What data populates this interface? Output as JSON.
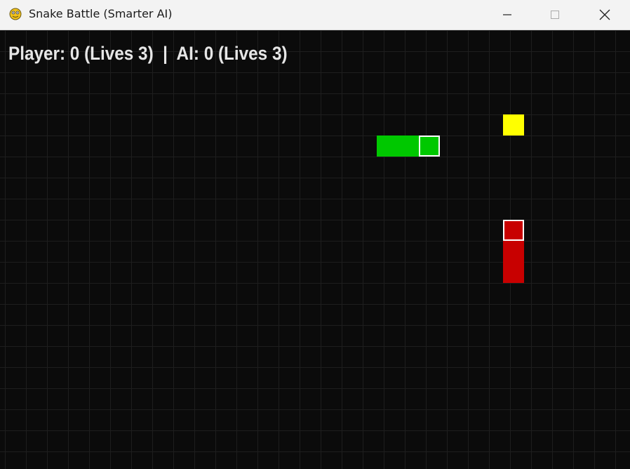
{
  "window": {
    "title": "Snake Battle (Smarter AI)",
    "app_icon": "pygame-snake-icon",
    "controls": [
      "minimize-icon",
      "maximize-icon",
      "close-icon"
    ]
  },
  "hud": {
    "player_label": "Player:",
    "player_score": 0,
    "player_lives": 3,
    "ai_label": "AI:",
    "ai_score": 0,
    "ai_lives": 3,
    "score_text": "Player: 0 (Lives 3)  |  AI: 0 (Lives 3)"
  },
  "colors": {
    "background": "#0b0b0b",
    "grid": "#1e1e1e",
    "player_snake": "#00c800",
    "ai_snake": "#c80000",
    "food": "#ffff00",
    "head_outline": "#ffffff"
  },
  "game": {
    "player_snake_length": 3,
    "player_direction": "right",
    "ai_snake_length": 3,
    "ai_direction": "up",
    "food_count": 1
  }
}
